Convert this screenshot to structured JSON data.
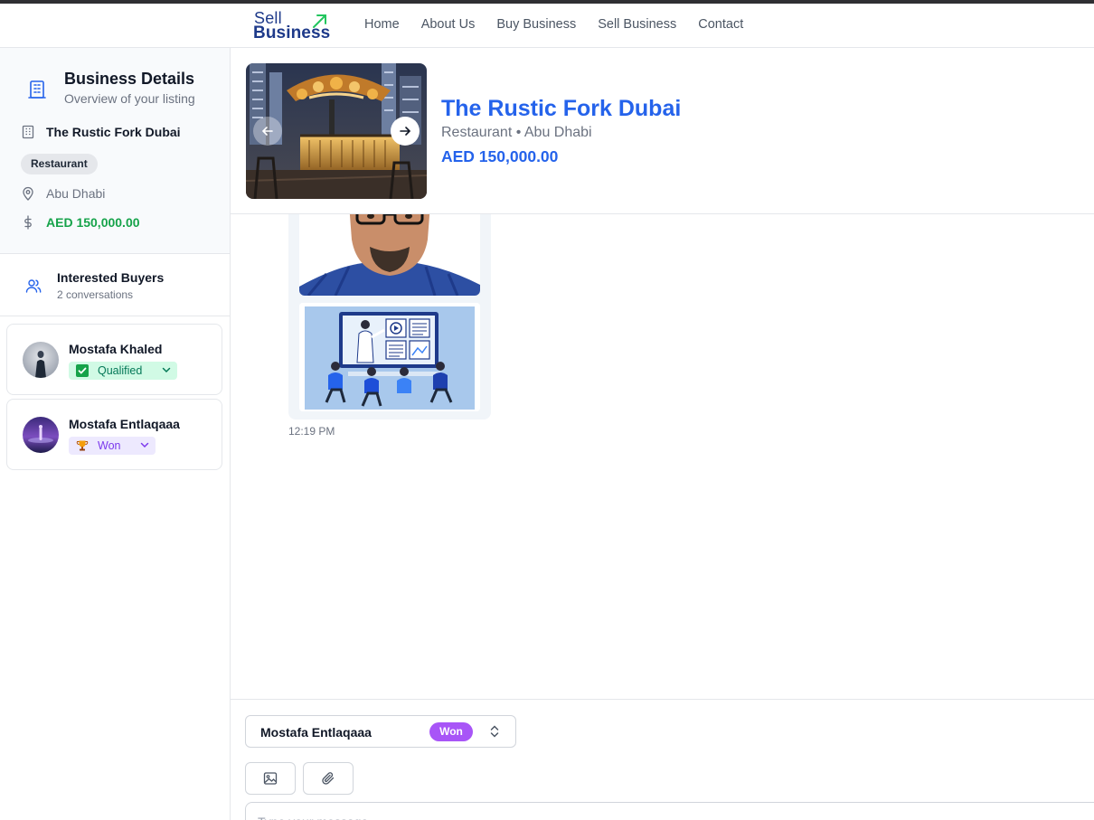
{
  "nav": {
    "logo_top": "Sell",
    "logo_bottom": "Business",
    "links": [
      "Home",
      "About Us",
      "Buy Business",
      "Sell Business",
      "Contact"
    ]
  },
  "sidebar": {
    "details": {
      "title": "Business Details",
      "subtitle": "Overview of your listing",
      "business_name": "The Rustic Fork Dubai",
      "category": "Restaurant",
      "location": "Abu Dhabi",
      "price": "AED 150,000.00"
    },
    "buyers": {
      "title": "Interested Buyers",
      "count_text": "2 conversations",
      "items": [
        {
          "name": "Mostafa Khaled",
          "status": "Qualified",
          "status_icon": "check-box-icon"
        },
        {
          "name": "Mostafa Entlaqaaa",
          "status": "Won",
          "status_icon": "trophy-icon"
        }
      ]
    }
  },
  "listing": {
    "title": "The Rustic Fork Dubai",
    "subtitle": "Restaurant • Abu Dhabi",
    "price": "AED 150,000.00"
  },
  "chat": {
    "message_time": "12:19 PM"
  },
  "composer": {
    "selected_buyer": "Mostafa Entlaqaaa",
    "selected_status": "Won",
    "input_placeholder": "Type your message..."
  },
  "colors": {
    "brand_blue": "#2563eb",
    "price_green": "#16a34a",
    "won_purple": "#a855f7",
    "qualified_green": "#047857"
  }
}
